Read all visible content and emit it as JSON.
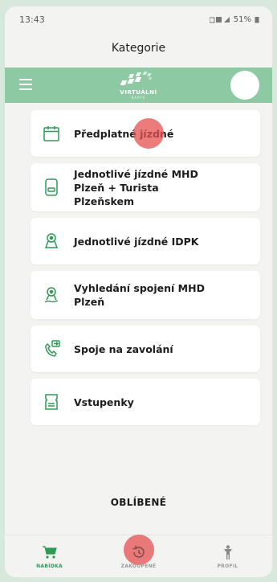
{
  "status": {
    "time": "13:43",
    "battery": "51%"
  },
  "page_title": "Kategorie",
  "logo": {
    "text": "VIRTUÁLNÍ",
    "sub": "KARTA"
  },
  "menu_items": [
    {
      "label": "Předplatné jízdné",
      "icon": "calendar-icon"
    },
    {
      "label": "Jednotlivé jízdné MHD Plzeň + Turista Plzeňskem",
      "icon": "phone-ticket-icon"
    },
    {
      "label": "Jednotlivé jízdné IDPK",
      "icon": "location-pin-icon"
    },
    {
      "label": "Vyhledání spojení MHD Plzeň",
      "icon": "route-pin-icon"
    },
    {
      "label": "Spoje na zavolání",
      "icon": "phone-call-icon"
    },
    {
      "label": "Vstupenky",
      "icon": "ticket-icon"
    }
  ],
  "favorites_label": "OBLÍBENÉ",
  "nav": [
    {
      "label": "NABÍDKA",
      "icon": "cart-icon",
      "active": true
    },
    {
      "label": "ZAKOUPENÉ",
      "icon": "history-icon",
      "active": false
    },
    {
      "label": "PROFIL",
      "icon": "person-icon",
      "active": false
    }
  ],
  "colors": {
    "accent": "#8dc9a3",
    "nav_active": "#2e9a55",
    "icon_green": "#2e9a55"
  }
}
